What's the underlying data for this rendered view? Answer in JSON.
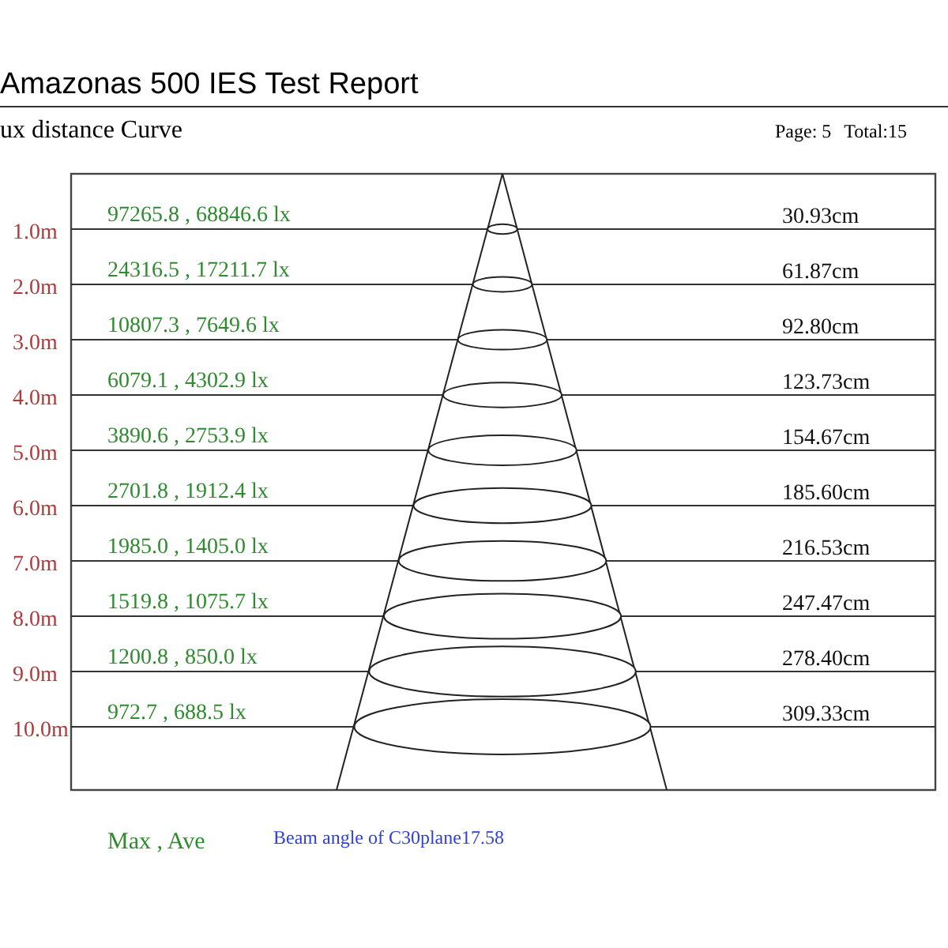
{
  "header": {
    "title": "Amazonas 500 IES Test Report",
    "subtitle": "ux distance Curve",
    "page": "Page: 5",
    "total": "Total:15"
  },
  "rows": [
    {
      "distance": "1.0m",
      "illuminance": "97265.8 , 68846.6 lx",
      "diameter": "30.93cm"
    },
    {
      "distance": "2.0m",
      "illuminance": "24316.5 , 17211.7 lx",
      "diameter": "61.87cm"
    },
    {
      "distance": "3.0m",
      "illuminance": "10807.3 , 7649.6 lx",
      "diameter": "92.80cm"
    },
    {
      "distance": "4.0m",
      "illuminance": "6079.1 , 4302.9 lx",
      "diameter": "123.73cm"
    },
    {
      "distance": "5.0m",
      "illuminance": "3890.6 , 2753.9 lx",
      "diameter": "154.67cm"
    },
    {
      "distance": "6.0m",
      "illuminance": "2701.8 , 1912.4 lx",
      "diameter": "185.60cm"
    },
    {
      "distance": "7.0m",
      "illuminance": "1985.0 , 1405.0 lx",
      "diameter": "216.53cm"
    },
    {
      "distance": "8.0m",
      "illuminance": "1519.8 , 1075.7 lx",
      "diameter": "247.47cm"
    },
    {
      "distance": "9.0m",
      "illuminance": "1200.8 , 850.0 lx",
      "diameter": "278.40cm"
    },
    {
      "distance": "10.0m",
      "illuminance": "972.7 , 688.5 lx",
      "diameter": "309.33cm"
    }
  ],
  "legend": "Max , Ave",
  "beam_angle": "Beam angle of C30plane17.58"
}
